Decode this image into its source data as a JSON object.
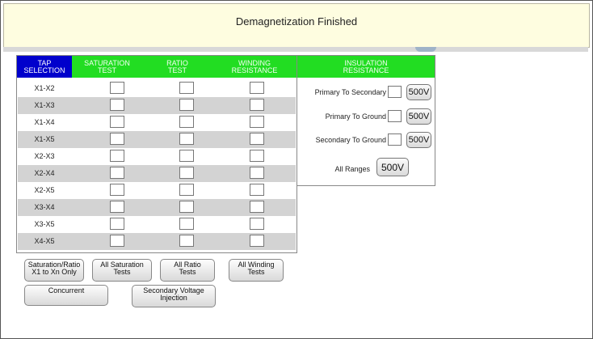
{
  "banner": {
    "text": "Demagnetization Finished"
  },
  "table": {
    "headers": {
      "tap": "TAP\nSELECTION",
      "saturation": "SATURATION\nTEST",
      "ratio": "RATIO\nTEST",
      "winding": "WINDING\nRESISTANCE"
    },
    "rows": [
      "X1-X2",
      "X1-X3",
      "X1-X4",
      "X1-X5",
      "X2-X3",
      "X2-X4",
      "X2-X5",
      "X3-X4",
      "X3-X5",
      "X4-X5"
    ]
  },
  "insulation": {
    "header": "INSULATION\nRESISTANCE",
    "primary_to_secondary": {
      "label": "Primary To Secondary",
      "voltage": "500V"
    },
    "primary_to_ground": {
      "label": "Primary To Ground",
      "voltage": "500V"
    },
    "secondary_to_ground": {
      "label": "Secondary To Ground",
      "voltage": "500V"
    },
    "all_ranges": {
      "label": "All Ranges",
      "voltage": "500V"
    }
  },
  "buttons": {
    "saturation_ratio_only": "Saturation/Ratio\nX1 to Xn Only",
    "all_saturation": "All Saturation\nTests",
    "all_ratio": "All Ratio\nTests",
    "all_winding": "All Winding\nTests",
    "concurrent": "Concurrent",
    "secondary_voltage_injection": "Secondary Voltage\nInjection"
  },
  "colors": {
    "header_green": "#22dd22",
    "header_blue": "#0000cc",
    "banner_bg": "#fefde0",
    "row_alt": "#d3d3d3"
  }
}
